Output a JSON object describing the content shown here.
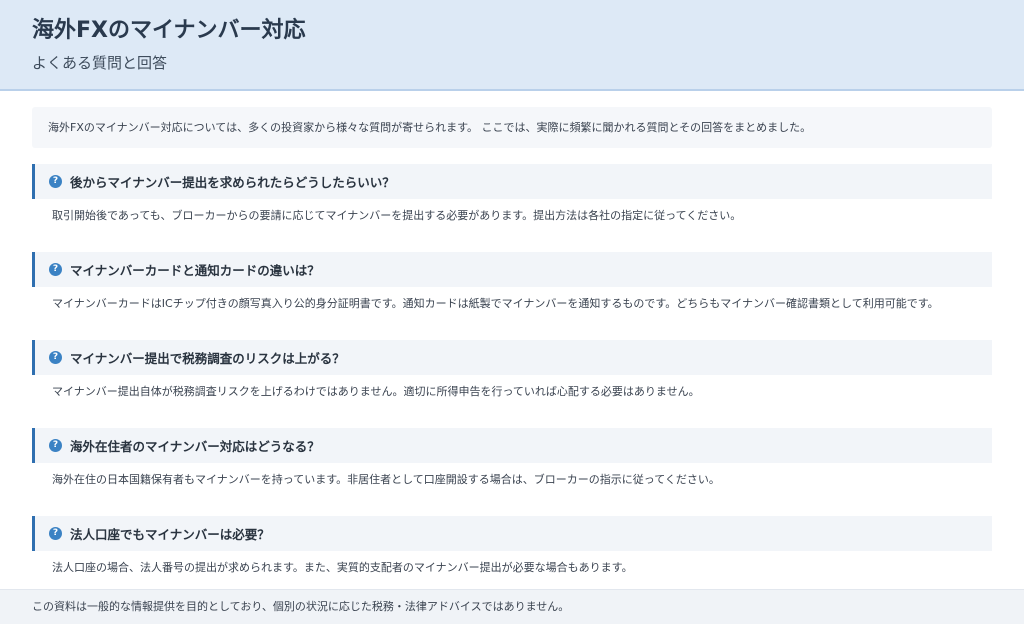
{
  "header": {
    "title": "海外FXのマイナンバー対応",
    "subtitle": "よくある質問と回答"
  },
  "intro": "海外FXのマイナンバー対応については、多くの投資家から様々な質問が寄せられます。 ここでは、実際に頻繁に聞かれる質問とその回答をまとめました。",
  "faq": [
    {
      "icon": "?",
      "question": "後からマイナンバー提出を求められたらどうしたらいい？",
      "answer": "取引開始後であっても、ブローカーからの要請に応じてマイナンバーを提出する必要があります。提出方法は各社の指定に従ってください。"
    },
    {
      "icon": "?",
      "question": "マイナンバーカードと通知カードの違いは？",
      "answer": "マイナンバーカードはICチップ付きの顔写真入り公的身分証明書です。通知カードは紙製でマイナンバーを通知するものです。どちらもマイナンバー確認書類として利用可能です。"
    },
    {
      "icon": "?",
      "question": "マイナンバー提出で税務調査のリスクは上がる？",
      "answer": "マイナンバー提出自体が税務調査リスクを上げるわけではありません。適切に所得申告を行っていれば心配する必要はありません。"
    },
    {
      "icon": "?",
      "question": "海外在住者のマイナンバー対応はどうなる？",
      "answer": "海外在住の日本国籍保有者もマイナンバーを持っています。非居住者として口座開設する場合は、ブローカーの指示に従ってください。"
    },
    {
      "icon": "?",
      "question": "法人口座でもマイナンバーは必要？",
      "answer": "法人口座の場合、法人番号の提出が求められます。また、実質的支配者のマイナンバー提出が必要な場合もあります。"
    }
  ],
  "footer": "この資料は一般的な情報提供を目的としており、個別の状況に応じた税務・法律アドバイスではありません。"
}
